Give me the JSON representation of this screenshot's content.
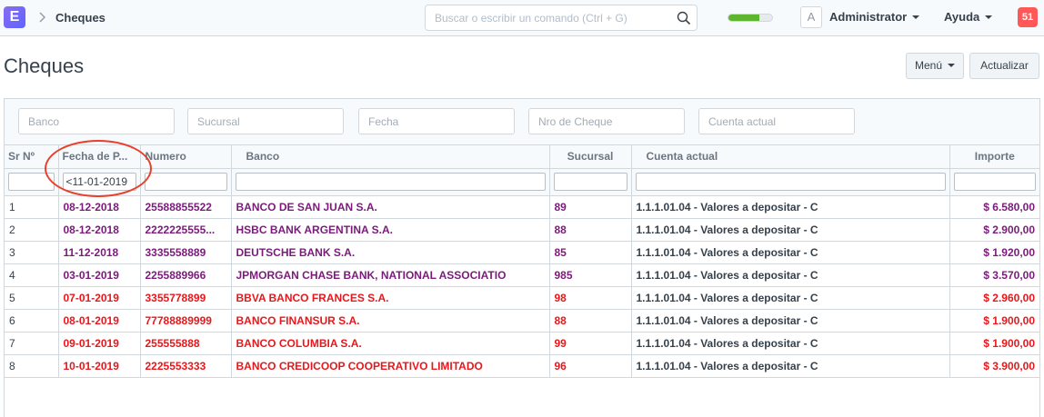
{
  "navbar": {
    "logo_letter": "E",
    "breadcrumb": "Cheques",
    "search_placeholder": "Buscar o escribir un comando (Ctrl + G)",
    "sync_progress": 0.7,
    "avatar_letter": "A",
    "user_label": "Administrator",
    "help_label": "Ayuda",
    "notification_count": "51"
  },
  "page": {
    "title": "Cheques",
    "menu_label": "Menú",
    "refresh_label": "Actualizar"
  },
  "filters": {
    "bank": "Banco",
    "branch": "Sucursal",
    "date": "Fecha",
    "cheque_number": "Nro de Cheque",
    "account": "Cuenta actual"
  },
  "table": {
    "columns": [
      "Sr Nº",
      "Fecha de P...",
      "Numero",
      "Banco",
      "Sucursal",
      "Cuenta actual",
      "Importe"
    ],
    "date_filter_value": "<11-01-2019",
    "rows": [
      {
        "sr": "1",
        "fecha": "08-12-2018",
        "numero": "25588855522",
        "banco": "BANCO DE SAN JUAN S.A.",
        "sucursal": "89",
        "cuenta": "1.1.1.01.04 - Valores a depositar - C",
        "importe": "$ 6.580,00",
        "color": "#7b1a7b"
      },
      {
        "sr": "2",
        "fecha": "08-12-2018",
        "numero": "2222225555...",
        "banco": "HSBC BANK ARGENTINA S.A.",
        "sucursal": "88",
        "cuenta": "1.1.1.01.04 - Valores a depositar - C",
        "importe": "$ 2.900,00",
        "color": "#7b1a7b"
      },
      {
        "sr": "3",
        "fecha": "11-12-2018",
        "numero": "3335558889",
        "banco": "DEUTSCHE BANK S.A.",
        "sucursal": "85",
        "cuenta": "1.1.1.01.04 - Valores a depositar - C",
        "importe": "$ 1.920,00",
        "color": "#7b1a7b"
      },
      {
        "sr": "4",
        "fecha": "03-01-2019",
        "numero": "2255889966",
        "banco": "JPMORGAN CHASE BANK, NATIONAL ASSOCIATIO",
        "sucursal": "985",
        "cuenta": "1.1.1.01.04 - Valores a depositar - C",
        "importe": "$ 3.570,00",
        "color": "#7b1a7b"
      },
      {
        "sr": "5",
        "fecha": "07-01-2019",
        "numero": "3355778899",
        "banco": "BBVA BANCO FRANCES S.A.",
        "sucursal": "98",
        "cuenta": "1.1.1.01.04 - Valores a depositar - C",
        "importe": "$ 2.960,00",
        "color": "#e8171b"
      },
      {
        "sr": "6",
        "fecha": "08-01-2019",
        "numero": "77788889999",
        "banco": "BANCO FINANSUR S.A.",
        "sucursal": "88",
        "cuenta": "1.1.1.01.04 - Valores a depositar - C",
        "importe": "$ 1.900,00",
        "color": "#e8171b"
      },
      {
        "sr": "7",
        "fecha": "09-01-2019",
        "numero": "255555888",
        "banco": "BANCO COLUMBIA S.A.",
        "sucursal": "99",
        "cuenta": "1.1.1.01.04 - Valores a depositar - C",
        "importe": "$ 1.900,00",
        "color": "#e8171b"
      },
      {
        "sr": "8",
        "fecha": "10-01-2019",
        "numero": "2225553333",
        "banco": "BANCO CREDICOOP COOPERATIVO LIMITADO",
        "sucursal": "96",
        "cuenta": "1.1.1.01.04 - Valores a depositar - C",
        "importe": "$ 3.900,00",
        "color": "#e8171b"
      }
    ]
  },
  "colors": {
    "accent": "#5e64ff",
    "progress": "#5eb62e",
    "notification": "#ff5858",
    "annotation_circle": "#e8402a"
  }
}
